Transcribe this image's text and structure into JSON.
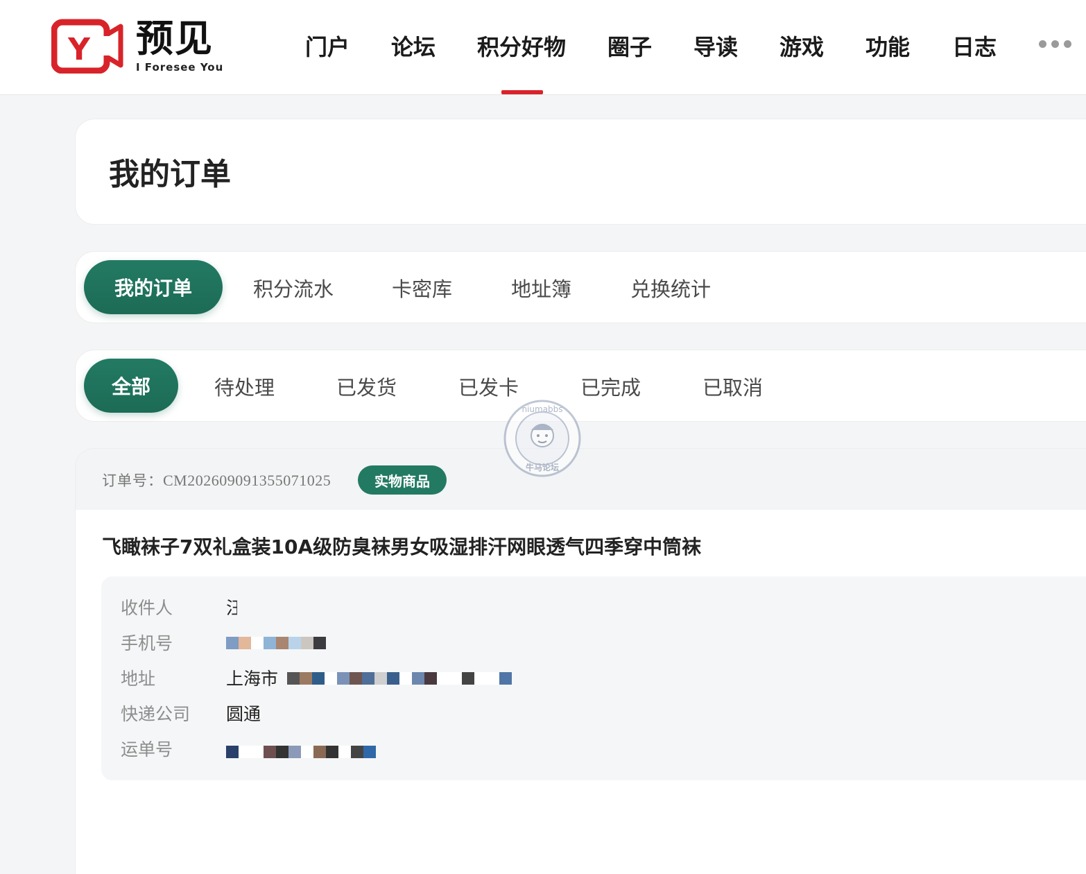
{
  "brand": {
    "name_cn": "预见",
    "tagline": "I Foresee You",
    "logo_letter": "Y",
    "accent_color": "#d8232a"
  },
  "nav": {
    "items": [
      {
        "label": "门户"
      },
      {
        "label": "论坛"
      },
      {
        "label": "积分好物",
        "active": true
      },
      {
        "label": "圈子"
      },
      {
        "label": "导读"
      },
      {
        "label": "游戏"
      },
      {
        "label": "功能"
      },
      {
        "label": "日志"
      }
    ],
    "more_icon": "more-dots-icon"
  },
  "page": {
    "title": "我的订单"
  },
  "main_tabs": {
    "active": "我的订单",
    "items": [
      "积分流水",
      "卡密库",
      "地址簿",
      "兑换统计"
    ]
  },
  "status_tabs": {
    "active": "全部",
    "items": [
      "待处理",
      "已发货",
      "已发卡",
      "已完成",
      "已取消"
    ]
  },
  "watermark": {
    "top_text": "niumabbs",
    "bottom_text": "牛马论坛"
  },
  "order": {
    "number_label": "订单号：",
    "number": "CM2026090913550710​25",
    "type_badge": "实物商品",
    "product_name": "飞瞰袜子7双礼盒装10A级防臭袜男女吸湿排汗网眼透气四季穿中筒袜",
    "details": {
      "recipient_label": "收件人",
      "recipient_value": "汪",
      "phone_label": "手机号",
      "phone_value": "",
      "address_label": "地址",
      "address_value": "上海市",
      "courier_label": "快递公司",
      "courier_value": "圆通",
      "tracking_label": "运单号",
      "tracking_value": ""
    }
  },
  "colors": {
    "primary_green": "#237a63",
    "background": "#f4f5f6"
  }
}
